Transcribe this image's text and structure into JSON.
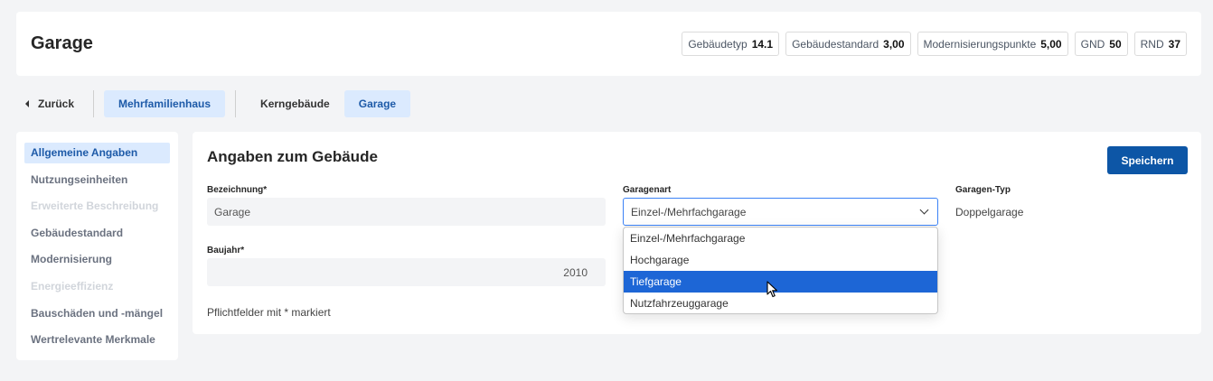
{
  "header": {
    "title": "Garage",
    "badges": [
      {
        "label": "Gebäudetyp",
        "value": "14.1"
      },
      {
        "label": "Gebäudestandard",
        "value": "3,00"
      },
      {
        "label": "Modernisierungspunkte",
        "value": "5,00"
      },
      {
        "label": "GND",
        "value": "50"
      },
      {
        "label": "RND",
        "value": "37"
      }
    ]
  },
  "nav": {
    "back_label": "Zurück",
    "crumbs": [
      "Mehrfamilienhaus",
      "Kerngebäude",
      "Garage"
    ]
  },
  "sidebar": {
    "items": [
      {
        "label": "Allgemeine Angaben",
        "state": "active"
      },
      {
        "label": "Nutzungseinheiten",
        "state": "normal"
      },
      {
        "label": "Erweiterte Beschreibung",
        "state": "disabled"
      },
      {
        "label": "Gebäudestandard",
        "state": "normal"
      },
      {
        "label": "Modernisierung",
        "state": "normal"
      },
      {
        "label": "Energieeffizienz",
        "state": "disabled"
      },
      {
        "label": "Bauschäden und -mängel",
        "state": "normal"
      },
      {
        "label": "Wertrelevante Merkmale",
        "state": "normal"
      }
    ]
  },
  "main": {
    "title": "Angaben zum Gebäude",
    "save_label": "Speichern",
    "bezeichnung_label": "Bezeichnung*",
    "bezeichnung_value": "Garage",
    "baujahr_label": "Baujahr*",
    "baujahr_value": "2010",
    "garagenart_label": "Garagenart",
    "garagenart_value": "Einzel-/Mehrfachgarage",
    "garagentyp_label": "Garagen-Typ",
    "garagentyp_value": "Doppelgarage",
    "note": "Pflichtfelder mit * markiert"
  },
  "dropdown": {
    "options": [
      "Einzel-/Mehrfachgarage",
      "Hochgarage",
      "Tiefgarage",
      "Nutzfahrzeuggarage"
    ],
    "highlighted": "Tiefgarage"
  },
  "colors": {
    "accent": "#0d56a6",
    "active_bg": "#dbeafe",
    "active_text": "#1d5aa8",
    "highlight": "#1d66d6"
  }
}
